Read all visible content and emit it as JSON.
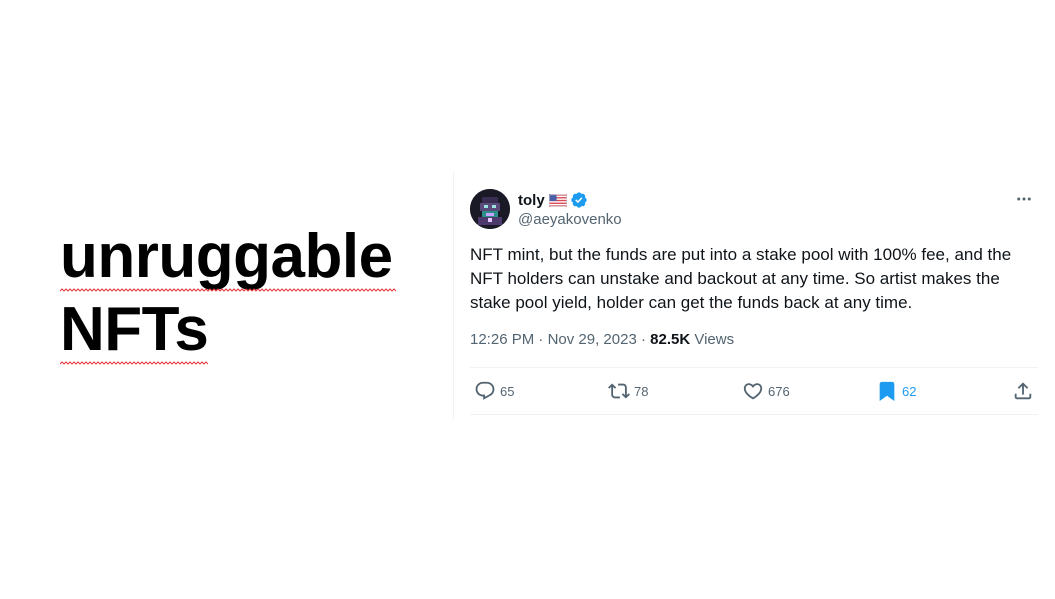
{
  "headline": {
    "line1": "unruggable",
    "line2": "NFTs"
  },
  "tweet": {
    "display_name": "toly",
    "flag": "🇺🇸",
    "handle": "@aeyakovenko",
    "text": "NFT mint, but the funds are put into a stake pool with 100% fee, and the NFT holders can unstake and backout at any time. So artist makes the stake pool yield, holder can get the funds back at any time.",
    "time": "12:26 PM",
    "date": "Nov 29, 2023",
    "views_count": "82.5K",
    "views_label": "Views",
    "separator": "·",
    "actions": {
      "replies": "65",
      "retweets": "78",
      "likes": "676",
      "bookmarks": "62"
    },
    "icons": {
      "more": "more-horizontal-icon",
      "reply": "reply-icon",
      "retweet": "retweet-icon",
      "like": "heart-icon",
      "bookmark": "bookmark-icon",
      "share": "share-icon",
      "verified": "verified-badge-icon"
    }
  },
  "colors": {
    "accent": "#1d9bf0",
    "text_primary": "#0f1419",
    "text_secondary": "#536471",
    "divider": "#eff3f4",
    "spellcheck_squiggle": "#e0393e"
  }
}
